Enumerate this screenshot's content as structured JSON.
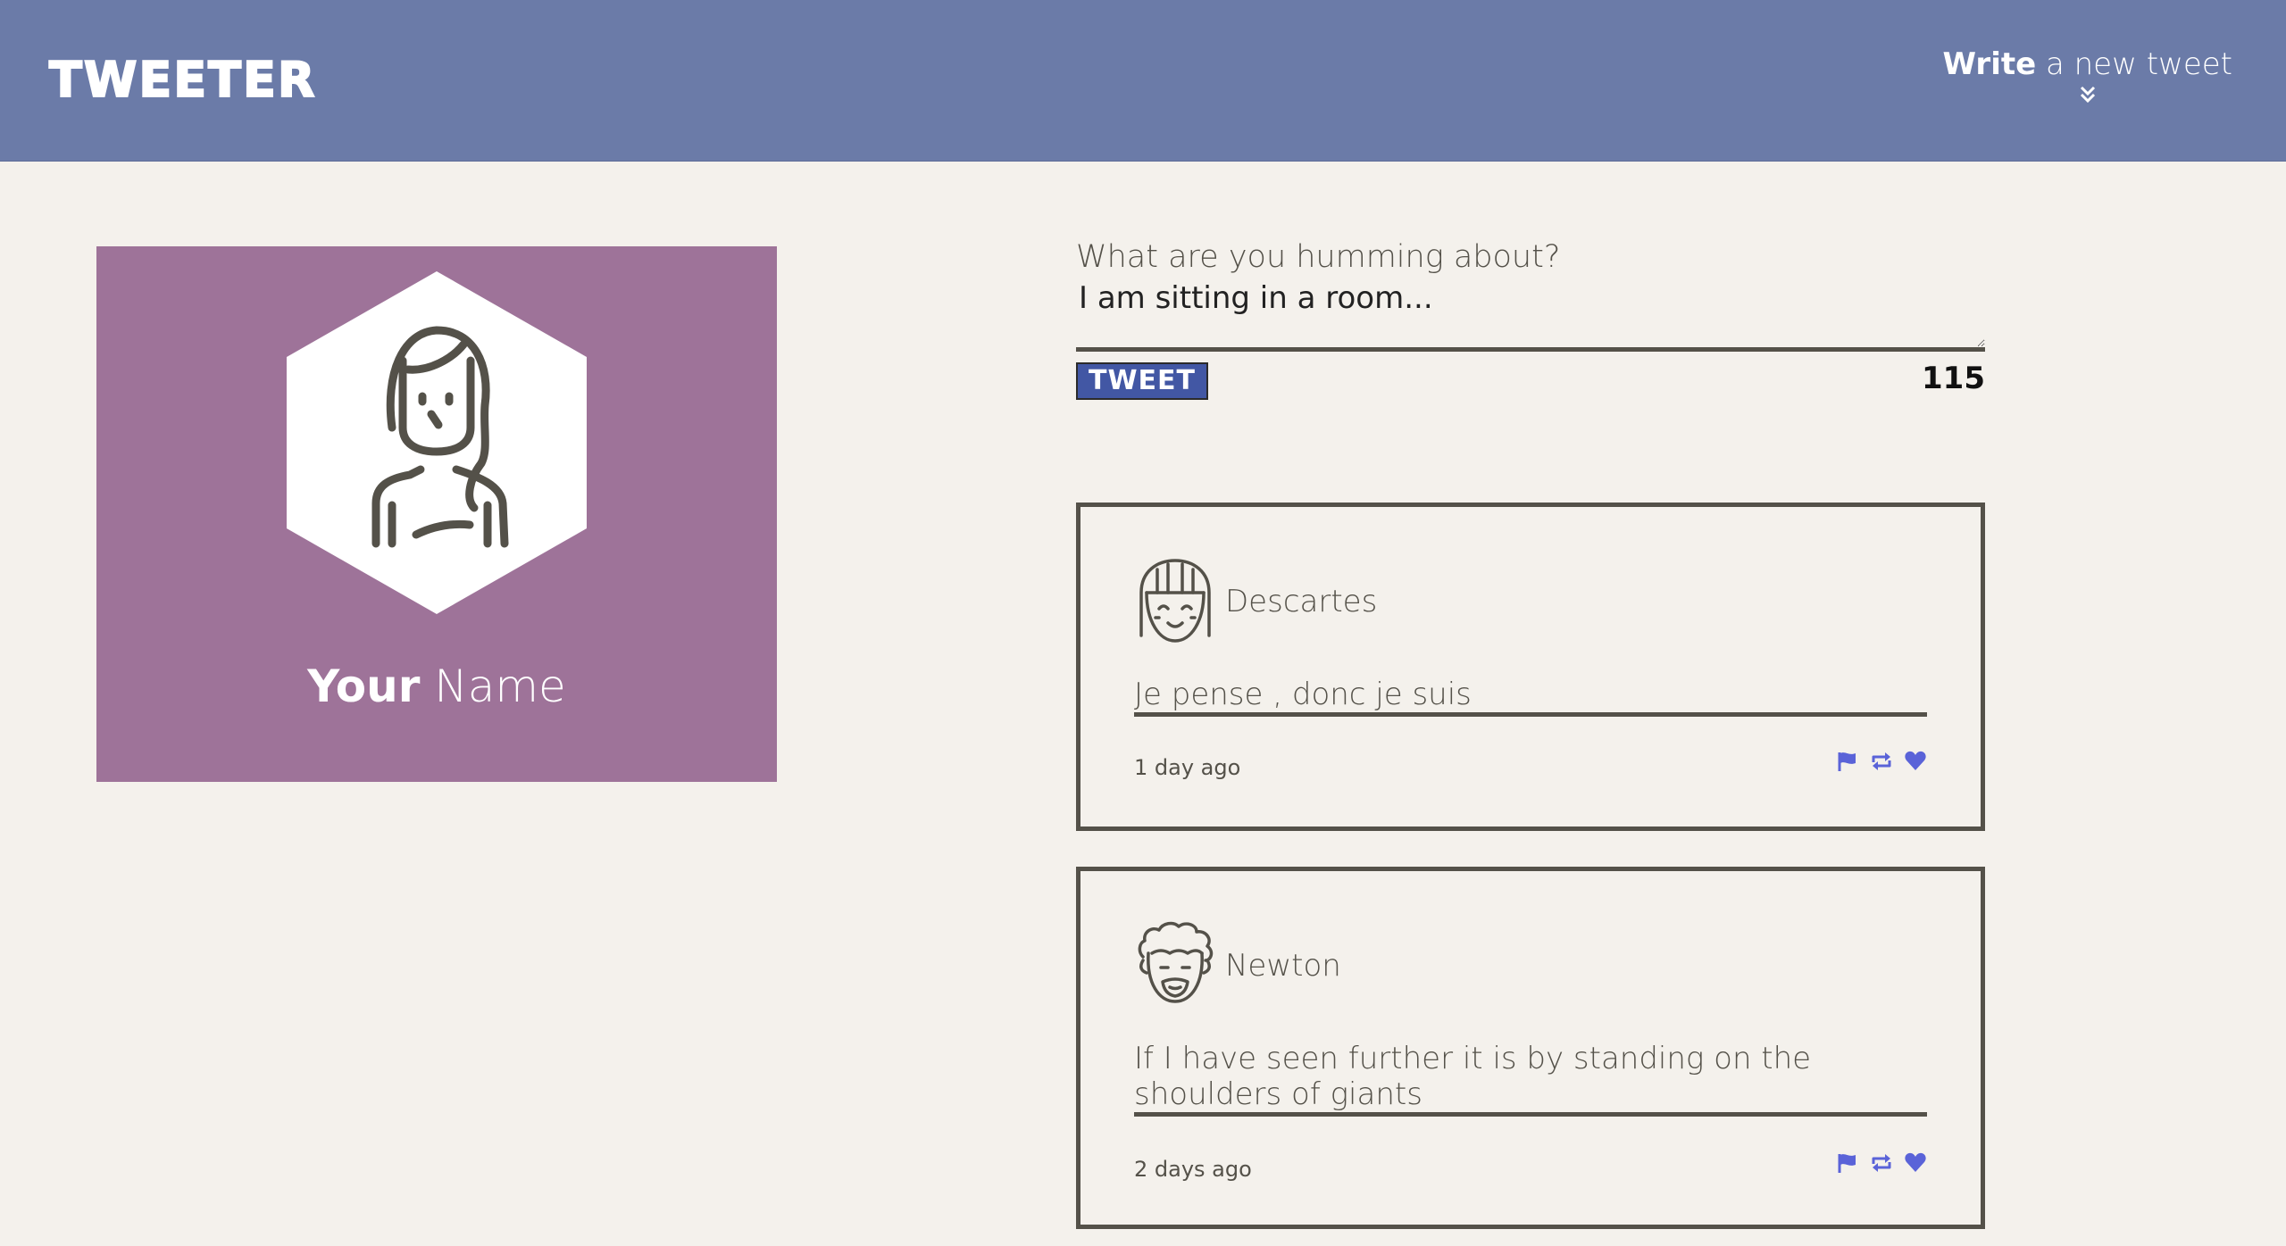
{
  "nav": {
    "brand": "TWEETER",
    "compose_toggle": {
      "bold": "Write",
      "rest": " a new tweet",
      "icon": "double-chevron-down-icon"
    }
  },
  "profile": {
    "name_bold": "Your",
    "name_rest": " Name",
    "avatar_icon": "woman-avatar-icon"
  },
  "composer": {
    "label": "What are you humming about?",
    "value": "I am sitting in a room...",
    "submit_label": "TWEET",
    "counter": "115"
  },
  "tweets": [
    {
      "author": "Descartes",
      "avatar_icon": "smiling-girl-avatar-icon",
      "content": "Je pense , donc je suis",
      "time": "1 day ago",
      "actions": [
        "flag-icon",
        "retweet-icon",
        "heart-icon"
      ]
    },
    {
      "author": "Newton",
      "avatar_icon": "curly-hair-man-avatar-icon",
      "content": "If I have seen further it is by standing on the shoulders of giants",
      "time": "2 days ago",
      "actions": [
        "flag-icon",
        "retweet-icon",
        "heart-icon"
      ]
    }
  ],
  "colors": {
    "nav_bg": "#6b7ba8",
    "page_bg": "#f4f1ec",
    "profile_bg": "#9e7399",
    "button_bg": "#4257a4",
    "action_icon": "#5a63d8",
    "text": "#545149"
  }
}
